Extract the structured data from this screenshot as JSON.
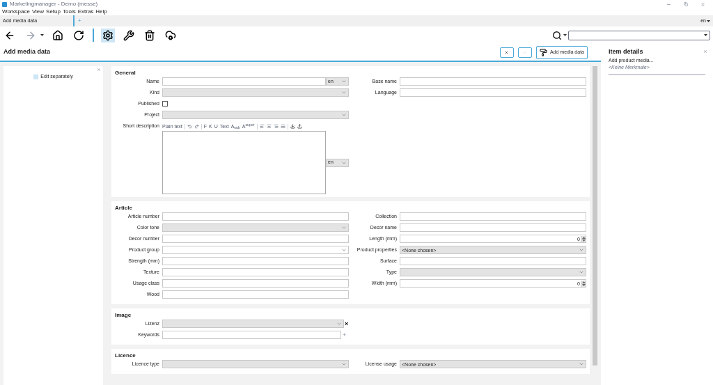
{
  "window": {
    "title": "Marketingmanager - Demo (messe)"
  },
  "menu": [
    "Workspace",
    "View",
    "Setup",
    "Tools",
    "Extras",
    "Help"
  ],
  "tabs": [
    {
      "label": "Add media data",
      "selected": true
    }
  ],
  "add_tab": "+",
  "ui_language": "en",
  "toolbar": [
    {
      "kind": "back",
      "disabled": false,
      "selected": false
    },
    {
      "kind": "forward",
      "disabled": true,
      "selected": false
    },
    {
      "kind": "home",
      "disabled": false,
      "selected": false
    },
    {
      "kind": "reload",
      "disabled": false,
      "selected": false
    },
    {
      "kind": "settings",
      "disabled": false,
      "selected": true
    },
    {
      "kind": "tools",
      "disabled": false,
      "selected": false
    },
    {
      "kind": "delete",
      "disabled": false,
      "selected": false
    },
    {
      "kind": "cloud",
      "disabled": false,
      "selected": false
    }
  ],
  "page": {
    "title": "Add media data",
    "confirm_disabled": true,
    "primary_button": "Add media data"
  },
  "left_panel": {
    "option": {
      "label": "Edit separately",
      "checked": false
    }
  },
  "sections": [
    {
      "title": "General",
      "left": [
        {
          "label": "Name",
          "kind": "text",
          "lang": "en"
        },
        {
          "label": "Kind",
          "kind": "select"
        },
        {
          "label": "Published",
          "kind": "checkbox",
          "checked": false
        },
        {
          "label": "Project",
          "kind": "select"
        },
        {
          "label": "Short description",
          "kind": "richtext",
          "lang": "en",
          "toolbar": [
            "Plain text",
            "F",
            "K",
            "U",
            "Text",
            "A$_{sub}$",
            "A$^{super}$"
          ]
        }
      ],
      "right": [
        {
          "label": "Base name",
          "kind": "text"
        },
        {
          "label": "Language",
          "kind": "text"
        }
      ]
    },
    {
      "title": "Article",
      "left": [
        {
          "label": "Article number",
          "kind": "text"
        },
        {
          "label": "Color tone",
          "kind": "select"
        },
        {
          "label": "Decor number",
          "kind": "text"
        },
        {
          "label": "Product group",
          "kind": "combo"
        },
        {
          "label": "Strength (mm)",
          "kind": "text"
        },
        {
          "label": "Texture",
          "kind": "text"
        },
        {
          "label": "Usage class",
          "kind": "text"
        },
        {
          "label": "Wood",
          "kind": "text"
        }
      ],
      "right": [
        {
          "label": "Collection",
          "kind": "text"
        },
        {
          "label": "Decor name",
          "kind": "text"
        },
        {
          "label": "Length (mm)",
          "kind": "number",
          "value": "0"
        },
        {
          "label": "Product properties",
          "kind": "select",
          "value": "<None chosen>"
        },
        {
          "label": "Surface",
          "kind": "text"
        },
        {
          "label": "Type",
          "kind": "select"
        },
        {
          "label": "Width (mm)",
          "kind": "number",
          "value": "0"
        }
      ]
    },
    {
      "title": "Image",
      "left": [
        {
          "label": "Lizenz",
          "kind": "select",
          "action": "×"
        },
        {
          "label": "Keywords",
          "kind": "text",
          "action": "+"
        }
      ]
    },
    {
      "title": "Licence",
      "left": [
        {
          "label": "Licence type",
          "kind": "select"
        }
      ],
      "right": [
        {
          "label": "License usage",
          "kind": "select",
          "value": "<None chosen>"
        }
      ]
    }
  ],
  "details": {
    "title": "Item details",
    "subtitle": "Add product media...",
    "note": "<Keine Merkmale>"
  }
}
